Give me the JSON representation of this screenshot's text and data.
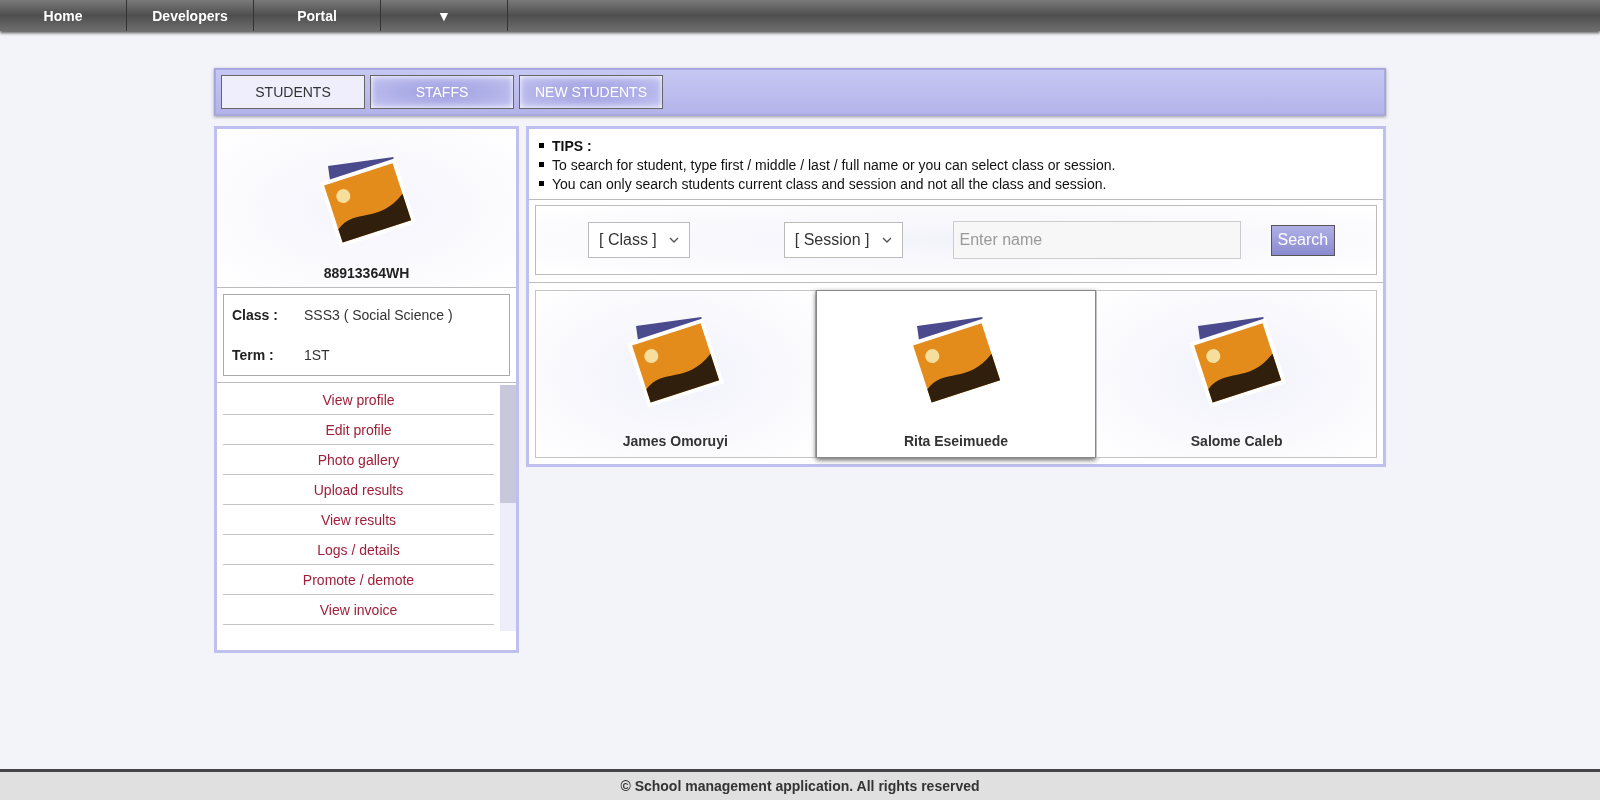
{
  "nav": {
    "items": [
      {
        "label": "Home"
      },
      {
        "label": "Developers"
      },
      {
        "label": "Portal"
      },
      {
        "label": "▼"
      }
    ]
  },
  "tabs": [
    {
      "label": "STUDENTS",
      "selected": true
    },
    {
      "label": "STAFFS",
      "selected": false
    },
    {
      "label": "NEW STUDENTS",
      "selected": false
    }
  ],
  "profile": {
    "id": "88913364WH",
    "fields": [
      {
        "label": "Class :",
        "value": "SSS3 ( Social Science )"
      },
      {
        "label": "Term :",
        "value": "1ST"
      }
    ],
    "menu": [
      "View profile",
      "Edit profile",
      "Photo gallery",
      "Upload results",
      "View results",
      "Logs / details",
      "Promote / demote",
      "View invoice"
    ]
  },
  "tips": {
    "title": "TIPS :",
    "items": [
      "To search for student, type first / middle / last / full name or you can select class or session.",
      "You can only search students current class and session and not all the class and session."
    ]
  },
  "search": {
    "class_select": "[ Class ]",
    "session_select": "[ Session ]",
    "name_placeholder": "Enter name",
    "button": "Search"
  },
  "students": [
    {
      "name": "James Omoruyi",
      "selected": false
    },
    {
      "name": "Rita Eseimuede",
      "selected": true
    },
    {
      "name": "Salome Caleb",
      "selected": false
    }
  ],
  "footer": "© School management application. All rights reserved"
}
